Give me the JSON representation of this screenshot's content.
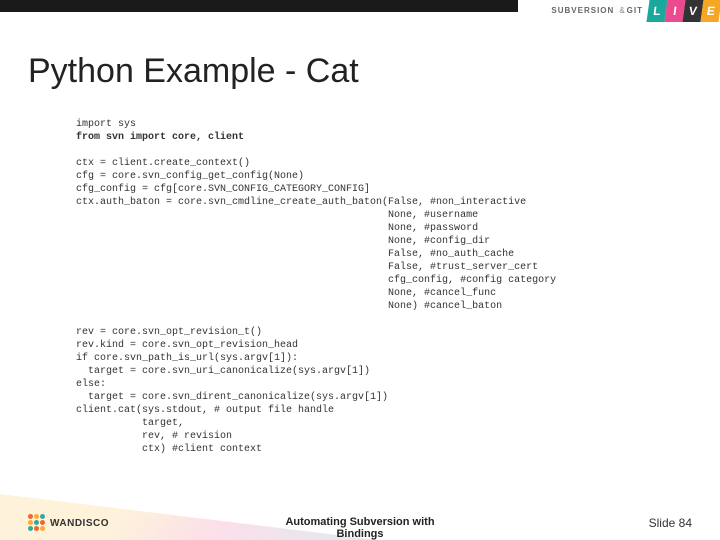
{
  "brand": {
    "sub": "SUBVERSION",
    "amp": "&",
    "git": "GIT",
    "live": [
      "L",
      "I",
      "V",
      "E"
    ]
  },
  "title": "Python Example - Cat",
  "code": {
    "l1": "import sys",
    "l2": "from svn import core, client",
    "blk1": "ctx = client.create_context()\ncfg = core.svn_config_get_config(None)\ncfg_config = cfg[core.SVN_CONFIG_CATEGORY_CONFIG]\nctx.auth_baton = core.svn_cmdline_create_auth_baton(False, #non_interactive\n                                                    None, #username\n                                                    None, #password\n                                                    None, #config_dir\n                                                    False, #no_auth_cache\n                                                    False, #trust_server_cert\n                                                    cfg_config, #config category\n                                                    None, #cancel_func\n                                                    None) #cancel_baton",
    "blk2": "rev = core.svn_opt_revision_t()\nrev.kind = core.svn_opt_revision_head\nif core.svn_path_is_url(sys.argv[1]):\n  target = core.svn_uri_canonicalize(sys.argv[1])\nelse:\n  target = core.svn_dirent_canonicalize(sys.argv[1])\nclient.cat(sys.stdout, # output file handle\n           target,\n           rev, # revision\n           ctx) #client context"
  },
  "footer": {
    "title": "Automating Subversion with\nBindings",
    "slide": "Slide 84",
    "brand": "WANDISCO"
  }
}
